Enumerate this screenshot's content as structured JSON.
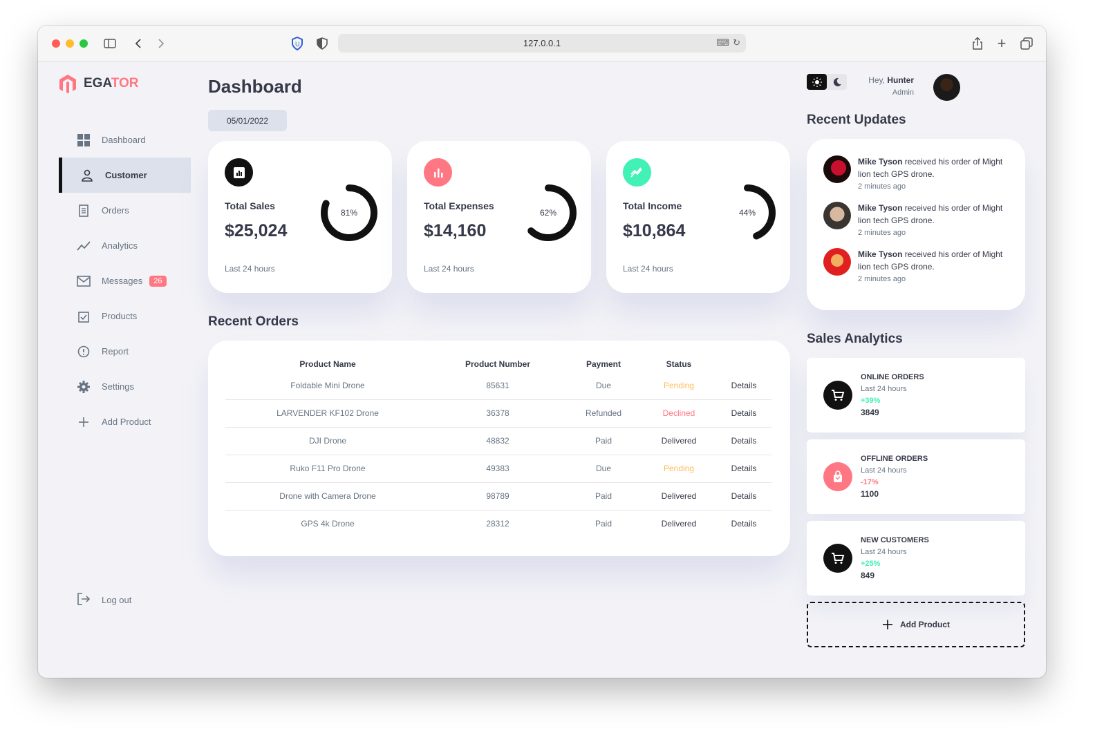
{
  "browser": {
    "url": "127.0.0.1"
  },
  "brand": {
    "part1": "EGA",
    "part2": "TOR"
  },
  "nav": [
    {
      "label": "Dashboard"
    },
    {
      "label": "Customer"
    },
    {
      "label": "Orders"
    },
    {
      "label": "Analytics"
    },
    {
      "label": "Messages",
      "badge": "26"
    },
    {
      "label": "Products"
    },
    {
      "label": "Report"
    },
    {
      "label": "Settings"
    },
    {
      "label": "Add Product"
    }
  ],
  "logout": "Log out",
  "page_title": "Dashboard",
  "date": "05/01/2022",
  "cards": [
    {
      "title": "Total Sales",
      "value": "$25,024",
      "percent": "81%",
      "percent_value": 0.81,
      "sub": "Last 24 hours"
    },
    {
      "title": "Total Expenses",
      "value": "$14,160",
      "percent": "62%",
      "percent_value": 0.62,
      "sub": "Last 24 hours"
    },
    {
      "title": "Total Income",
      "value": "$10,864",
      "percent": "44%",
      "percent_value": 0.44,
      "sub": "Last 24 hours"
    }
  ],
  "orders": {
    "heading": "Recent Orders",
    "columns": [
      "Product Name",
      "Product Number",
      "Payment",
      "Status"
    ],
    "rows": [
      {
        "name": "Foldable Mini Drone",
        "number": "85631",
        "payment": "Due",
        "status": "Pending",
        "details": "Details"
      },
      {
        "name": "LARVENDER KF102 Drone",
        "number": "36378",
        "payment": "Refunded",
        "status": "Declined",
        "details": "Details"
      },
      {
        "name": "DJI Drone",
        "number": "48832",
        "payment": "Paid",
        "status": "Delivered",
        "details": "Details"
      },
      {
        "name": "Ruko F11 Pro Drone",
        "number": "49383",
        "payment": "Due",
        "status": "Pending",
        "details": "Details"
      },
      {
        "name": "Drone with Camera Drone",
        "number": "98789",
        "payment": "Paid",
        "status": "Delivered",
        "details": "Details"
      },
      {
        "name": "GPS 4k Drone",
        "number": "28312",
        "payment": "Paid",
        "status": "Delivered",
        "details": "Details"
      }
    ]
  },
  "user": {
    "greeting": "Hey,",
    "name": "Hunter",
    "role": "Admin"
  },
  "updates": {
    "heading": "Recent Updates",
    "items": [
      {
        "name": "Mike Tyson",
        "text": " received his order of Might lion tech GPS drone.",
        "time": "2 minutes ago"
      },
      {
        "name": "Mike Tyson",
        "text": " received his order of Might lion tech GPS drone.",
        "time": "2 minutes ago"
      },
      {
        "name": "Mike Tyson",
        "text": " received his order of Might lion tech GPS drone.",
        "time": "2 minutes ago"
      }
    ]
  },
  "sales": {
    "heading": "Sales Analytics",
    "items": [
      {
        "title": "ONLINE ORDERS",
        "sub": "Last 24 hours",
        "change": "+39%",
        "value": "3849"
      },
      {
        "title": "OFFLINE ORDERS",
        "sub": "Last 24 hours",
        "change": "-17%",
        "value": "1100"
      },
      {
        "title": "NEW CUSTOMERS",
        "sub": "Last 24 hours",
        "change": "+25%",
        "value": "849"
      }
    ],
    "add_label": "Add Product"
  },
  "colors": {
    "primary": "#7380ec",
    "danger": "#ff7782",
    "success": "#41f1b6",
    "warning": "#ffbb55"
  }
}
